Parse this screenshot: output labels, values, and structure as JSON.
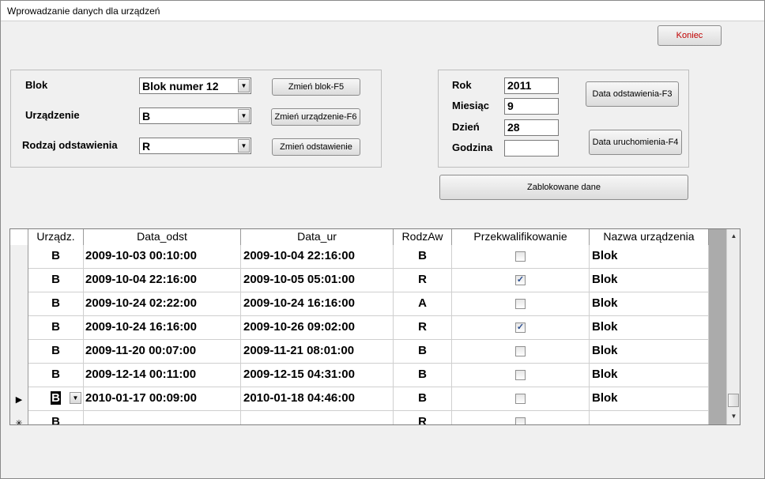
{
  "window": {
    "title": "Wprowadzanie danych dla urządzeń"
  },
  "buttons": {
    "koniec": "Koniec",
    "zmien_blok": "Zmień blok-F5",
    "zmien_urzadzenie": "Zmień urządzenie-F6",
    "zmien_odstawienie": "Zmień odstawienie",
    "data_odstawienia": "Data odstawienia-F3",
    "data_uruchomienia": "Data uruchomienia-F4",
    "zablokowane": "Zablokowane dane"
  },
  "left_panel": {
    "blok_label": "Blok",
    "blok_value": "Blok numer 12",
    "urzadzenie_label": "Urządzenie",
    "urzadzenie_value": "B",
    "rodzaj_label": "Rodzaj odstawienia",
    "rodzaj_value": "R"
  },
  "right_panel": {
    "rok_label": "Rok",
    "rok_value": "2011",
    "miesiac_label": "Miesiąc",
    "miesiac_value": "9",
    "dzien_label": "Dzień",
    "dzien_value": "28",
    "godzina_label": "Godzina",
    "godzina_value": ""
  },
  "grid": {
    "headers": [
      "Urządz.",
      "Data_odst",
      "Data_ur",
      "RodzAw",
      "Przekwalifikowanie",
      "Nazwa urządzenia"
    ],
    "rows": [
      {
        "urzadz": "B",
        "data_odst": "2009-10-03 00:10:00",
        "data_ur": "2009-10-04 22:16:00",
        "rodzaw": "B",
        "przekw": false,
        "nazwa": "Blok"
      },
      {
        "urzadz": "B",
        "data_odst": "2009-10-04 22:16:00",
        "data_ur": "2009-10-05 05:01:00",
        "rodzaw": "R",
        "przekw": true,
        "nazwa": "Blok"
      },
      {
        "urzadz": "B",
        "data_odst": "2009-10-24 02:22:00",
        "data_ur": "2009-10-24 16:16:00",
        "rodzaw": "A",
        "przekw": false,
        "nazwa": "Blok"
      },
      {
        "urzadz": "B",
        "data_odst": "2009-10-24 16:16:00",
        "data_ur": "2009-10-26 09:02:00",
        "rodzaw": "R",
        "przekw": true,
        "nazwa": "Blok"
      },
      {
        "urzadz": "B",
        "data_odst": "2009-11-20 00:07:00",
        "data_ur": "2009-11-21 08:01:00",
        "rodzaw": "B",
        "przekw": false,
        "nazwa": "Blok"
      },
      {
        "urzadz": "B",
        "data_odst": "2009-12-14 00:11:00",
        "data_ur": "2009-12-15 04:31:00",
        "rodzaw": "B",
        "przekw": false,
        "nazwa": "Blok"
      },
      {
        "urzadz": "B",
        "data_odst": "2010-01-17 00:09:00",
        "data_ur": "2010-01-18 04:46:00",
        "rodzaw": "B",
        "przekw": false,
        "nazwa": "Blok",
        "current": true
      },
      {
        "urzadz": "B",
        "data_odst": "",
        "data_ur": "",
        "rodzaw": "R",
        "przekw": false,
        "nazwa": "",
        "new": true
      }
    ]
  },
  "icons": {
    "current_row": "▶",
    "new_row": "✳",
    "dropdown": "▼",
    "scroll_up": "▲",
    "scroll_down": "▼",
    "check": "✓"
  }
}
